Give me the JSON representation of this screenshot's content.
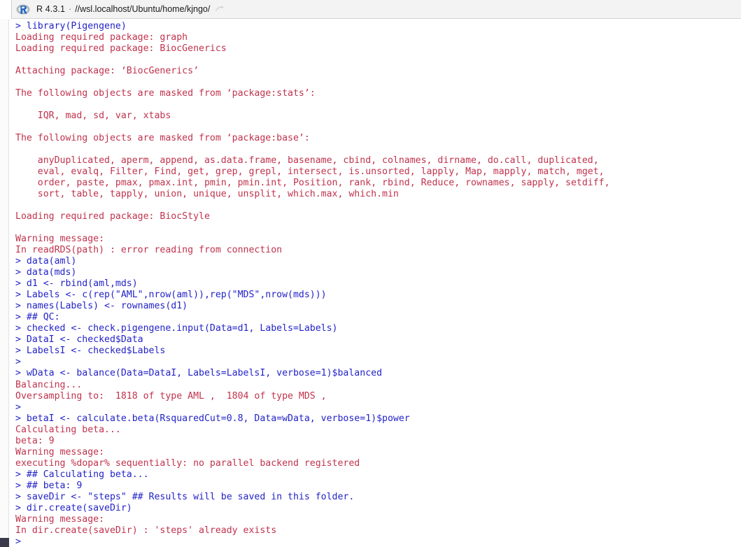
{
  "titlebar": {
    "app_version": "R 4.3.1",
    "separator": "·",
    "path": "//wsl.localhost/Ubuntu/home/kjngo/",
    "logo_letter": "R",
    "logo_icon": "r-logo-icon",
    "arrow_icon": "arrow-pointer-icon"
  },
  "console": {
    "lines": [
      {
        "type": "cmd",
        "text": "> library(Pigengene)"
      },
      {
        "type": "out",
        "text": "Loading required package: graph"
      },
      {
        "type": "out",
        "text": "Loading required package: BiocGenerics"
      },
      {
        "type": "blank",
        "text": ""
      },
      {
        "type": "out",
        "text": "Attaching package: ‘BiocGenerics’"
      },
      {
        "type": "blank",
        "text": ""
      },
      {
        "type": "out",
        "text": "The following objects are masked from ‘package:stats’:"
      },
      {
        "type": "blank",
        "text": ""
      },
      {
        "type": "out",
        "text": "    IQR, mad, sd, var, xtabs"
      },
      {
        "type": "blank",
        "text": ""
      },
      {
        "type": "out",
        "text": "The following objects are masked from ‘package:base’:"
      },
      {
        "type": "blank",
        "text": ""
      },
      {
        "type": "out",
        "text": "    anyDuplicated, aperm, append, as.data.frame, basename, cbind, colnames, dirname, do.call, duplicated,"
      },
      {
        "type": "out",
        "text": "    eval, evalq, Filter, Find, get, grep, grepl, intersect, is.unsorted, lapply, Map, mapply, match, mget,"
      },
      {
        "type": "out",
        "text": "    order, paste, pmax, pmax.int, pmin, pmin.int, Position, rank, rbind, Reduce, rownames, sapply, setdiff,"
      },
      {
        "type": "out",
        "text": "    sort, table, tapply, union, unique, unsplit, which.max, which.min"
      },
      {
        "type": "blank",
        "text": ""
      },
      {
        "type": "out",
        "text": "Loading required package: BiocStyle"
      },
      {
        "type": "blank",
        "text": ""
      },
      {
        "type": "out",
        "text": "Warning message:"
      },
      {
        "type": "out",
        "text": "In readRDS(path) : error reading from connection"
      },
      {
        "type": "cmd",
        "text": "> data(aml)"
      },
      {
        "type": "cmd",
        "text": "> data(mds)"
      },
      {
        "type": "cmd",
        "text": "> d1 <- rbind(aml,mds)"
      },
      {
        "type": "cmd",
        "text": "> Labels <- c(rep(\"AML\",nrow(aml)),rep(\"MDS\",nrow(mds)))"
      },
      {
        "type": "cmd",
        "text": "> names(Labels) <- rownames(d1)"
      },
      {
        "type": "cmd",
        "text": "> ## QC:"
      },
      {
        "type": "cmd",
        "text": "> checked <- check.pigengene.input(Data=d1, Labels=Labels)"
      },
      {
        "type": "cmd",
        "text": "> DataI <- checked$Data"
      },
      {
        "type": "cmd",
        "text": "> LabelsI <- checked$Labels"
      },
      {
        "type": "cmd",
        "text": "> "
      },
      {
        "type": "cmd",
        "text": "> wData <- balance(Data=DataI, Labels=LabelsI, verbose=1)$balanced"
      },
      {
        "type": "out",
        "text": "Balancing..."
      },
      {
        "type": "out",
        "text": "Oversampling to:  1818 of type AML ,  1804 of type MDS ,"
      },
      {
        "type": "cmd",
        "text": "> "
      },
      {
        "type": "cmd",
        "text": "> betaI <- calculate.beta(RsquaredCut=0.8, Data=wData, verbose=1)$power"
      },
      {
        "type": "out",
        "text": "Calculating beta..."
      },
      {
        "type": "out",
        "text": "beta: 9"
      },
      {
        "type": "out",
        "text": "Warning message:"
      },
      {
        "type": "out",
        "text": "executing %dopar% sequentially: no parallel backend registered"
      },
      {
        "type": "cmd",
        "text": "> ## Calculating beta..."
      },
      {
        "type": "cmd",
        "text": "> ## beta: 9"
      },
      {
        "type": "cmd",
        "text": "> saveDir <- \"steps\" ## Results will be saved in this folder."
      },
      {
        "type": "cmd",
        "text": "> dir.create(saveDir)"
      },
      {
        "type": "out",
        "text": "Warning message:"
      },
      {
        "type": "out",
        "text": "In dir.create(saveDir) : 'steps' already exists"
      },
      {
        "type": "cmd",
        "text": "> "
      }
    ]
  },
  "colors": {
    "command": "#2323c8",
    "output": "#c0334d",
    "background": "#ffffff",
    "titlebar": "#f3f3f3"
  }
}
